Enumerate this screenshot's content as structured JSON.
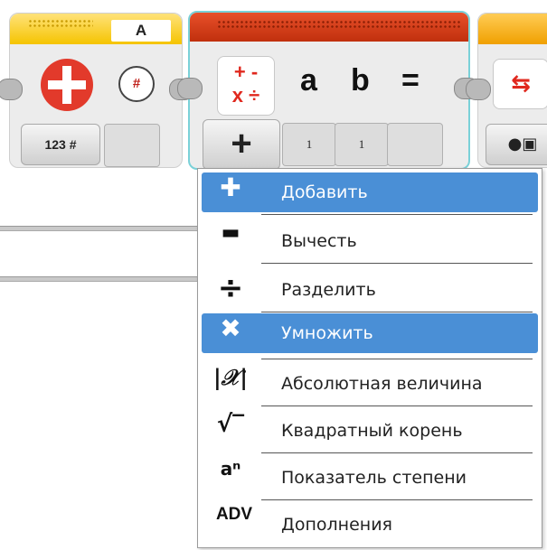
{
  "sensor_block": {
    "port": "A",
    "round_symbol": "#",
    "mode_label": "123 #"
  },
  "math_block": {
    "icon_text": "+ -\nx ÷",
    "param_a": "a",
    "param_b": "b",
    "equals": "=",
    "operation_symbol": "+",
    "value_a": "1",
    "value_b": "1",
    "icon": "math-operations-icon"
  },
  "colors": {
    "math_header": "#d03a14",
    "sensor_header": "#f5c400",
    "selection": "#4a8fd6",
    "block_outline": "#7ad1d8"
  },
  "menu": {
    "items": [
      {
        "icon": "plus-icon",
        "glyph": "✚",
        "label": "Добавить",
        "selected": true
      },
      {
        "icon": "minus-icon",
        "glyph": "▬",
        "label": "Вычесть",
        "selected": false
      },
      {
        "icon": "divide-icon",
        "glyph": "÷",
        "label": "Разделить",
        "selected": false
      },
      {
        "icon": "multiply-icon",
        "glyph": "✖",
        "label": "Умножить",
        "selected": true
      },
      {
        "icon": "absolute-value-icon",
        "glyph": "|𝒳|",
        "label": "Абсолютная величина",
        "selected": false
      },
      {
        "icon": "square-root-icon",
        "glyph": "√‾",
        "label": "Квадратный корень",
        "selected": false
      },
      {
        "icon": "exponent-icon",
        "glyph": "aⁿ",
        "label": "Показатель степени",
        "selected": false
      },
      {
        "icon": "advanced-icon",
        "glyph": "ADV",
        "label": "Дополнения",
        "selected": false
      }
    ]
  }
}
